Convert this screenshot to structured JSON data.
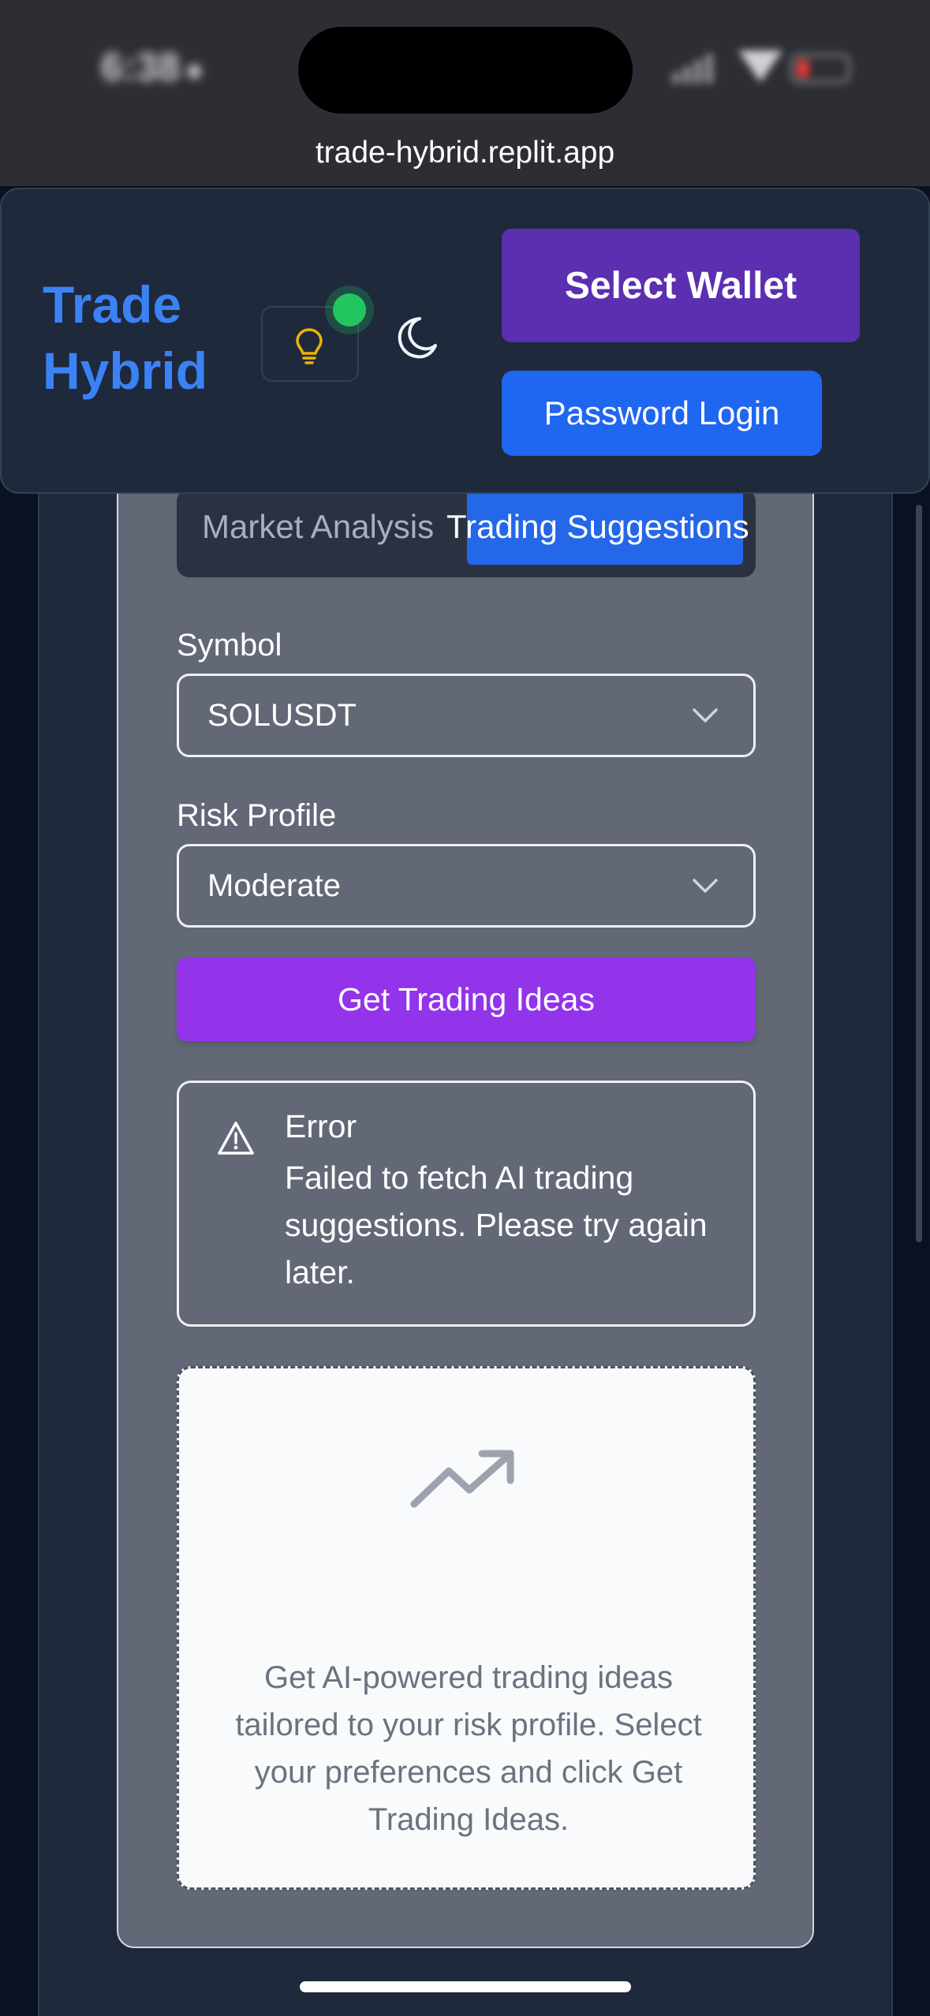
{
  "status_bar": {
    "time": "6:38",
    "url": "trade-hybrid.replit.app"
  },
  "header": {
    "brand_line1": "Trade",
    "brand_line2": "Hybrid",
    "select_wallet_label": "Select Wallet",
    "password_login_label": "Password Login"
  },
  "tabs": [
    {
      "label": "Market Analysis",
      "active": false
    },
    {
      "label": "Trading Suggestions",
      "active": true
    }
  ],
  "form": {
    "symbol_label": "Symbol",
    "symbol_value": "SOLUSDT",
    "risk_label": "Risk Profile",
    "risk_value": "Moderate",
    "submit_label": "Get Trading Ideas"
  },
  "alert": {
    "title": "Error",
    "message": "Failed to fetch AI trading suggestions. Please try again later."
  },
  "empty_state": {
    "icon": "trending-up-icon",
    "message": "Get AI-powered trading ideas tailored to your risk profile. Select your preferences and click Get Trading Ideas."
  },
  "colors": {
    "brand": "#3b82f6",
    "wallet_button": "#5b2fb0",
    "password_button": "#1f66f0",
    "ideas_button": "#9333ea",
    "active_tab": "#2467e8",
    "online": "#22c55e"
  }
}
